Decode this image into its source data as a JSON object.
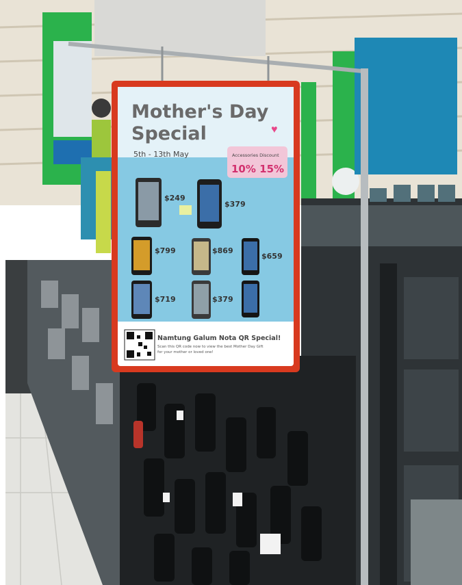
{
  "poster": {
    "title_line1": "Mother's Day",
    "title_line2": "Special",
    "date_range": "5th - 13th May",
    "discount_caption": "Accessories Discount",
    "discount_values": "10% 15%",
    "prices": [
      "$249",
      "$379",
      "$799",
      "$869",
      "$659",
      "$719",
      "$379"
    ],
    "qr_heading": "Namtung Galum  Nota QR Special!",
    "qr_body_line1": "Scan this QR code now to view the best Mother Day Gift",
    "qr_body_line2": "for your mother or loved one!"
  },
  "colors": {
    "poster_border": "#d83a1f",
    "poster_blue": "#86c9e3",
    "store_green": "#2bb24c",
    "store_blue": "#1e88b5",
    "shelf_dark": "#2e3336"
  }
}
